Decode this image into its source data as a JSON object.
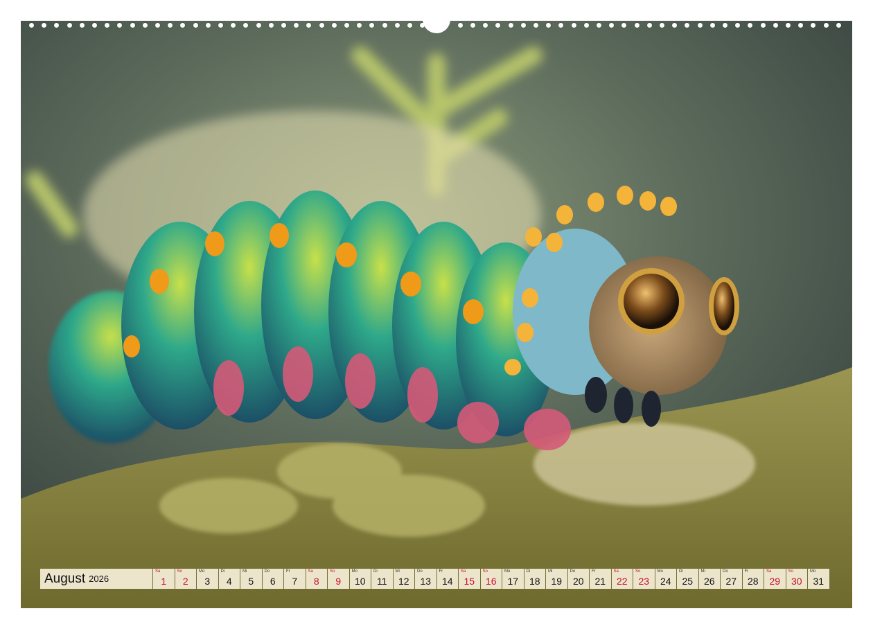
{
  "calendar": {
    "month": "August",
    "year": "2026",
    "days": [
      {
        "abbr": "Sa",
        "num": "1",
        "weekend": true
      },
      {
        "abbr": "So",
        "num": "2",
        "weekend": true
      },
      {
        "abbr": "Mo",
        "num": "3",
        "weekend": false
      },
      {
        "abbr": "Di",
        "num": "4",
        "weekend": false
      },
      {
        "abbr": "Mi",
        "num": "5",
        "weekend": false
      },
      {
        "abbr": "Do",
        "num": "6",
        "weekend": false
      },
      {
        "abbr": "Fr",
        "num": "7",
        "weekend": false
      },
      {
        "abbr": "Sa",
        "num": "8",
        "weekend": true
      },
      {
        "abbr": "So",
        "num": "9",
        "weekend": true
      },
      {
        "abbr": "Mo",
        "num": "10",
        "weekend": false
      },
      {
        "abbr": "Di",
        "num": "11",
        "weekend": false
      },
      {
        "abbr": "Mi",
        "num": "12",
        "weekend": false
      },
      {
        "abbr": "Do",
        "num": "13",
        "weekend": false
      },
      {
        "abbr": "Fr",
        "num": "14",
        "weekend": false
      },
      {
        "abbr": "Sa",
        "num": "15",
        "weekend": true
      },
      {
        "abbr": "So",
        "num": "16",
        "weekend": true
      },
      {
        "abbr": "Mo",
        "num": "17",
        "weekend": false
      },
      {
        "abbr": "Di",
        "num": "18",
        "weekend": false
      },
      {
        "abbr": "Mi",
        "num": "19",
        "weekend": false
      },
      {
        "abbr": "Do",
        "num": "20",
        "weekend": false
      },
      {
        "abbr": "Fr",
        "num": "21",
        "weekend": false
      },
      {
        "abbr": "Sa",
        "num": "22",
        "weekend": true
      },
      {
        "abbr": "So",
        "num": "23",
        "weekend": true
      },
      {
        "abbr": "Mo",
        "num": "24",
        "weekend": false
      },
      {
        "abbr": "Di",
        "num": "25",
        "weekend": false
      },
      {
        "abbr": "Mi",
        "num": "26",
        "weekend": false
      },
      {
        "abbr": "Do",
        "num": "27",
        "weekend": false
      },
      {
        "abbr": "Fr",
        "num": "28",
        "weekend": false
      },
      {
        "abbr": "Sa",
        "num": "29",
        "weekend": true
      },
      {
        "abbr": "So",
        "num": "30",
        "weekend": true
      },
      {
        "abbr": "Mo",
        "num": "31",
        "weekend": false
      }
    ]
  },
  "colors": {
    "weekend": "#c8102e",
    "cell_bg": "#ece5cc",
    "page_bg": "#ffffff"
  }
}
